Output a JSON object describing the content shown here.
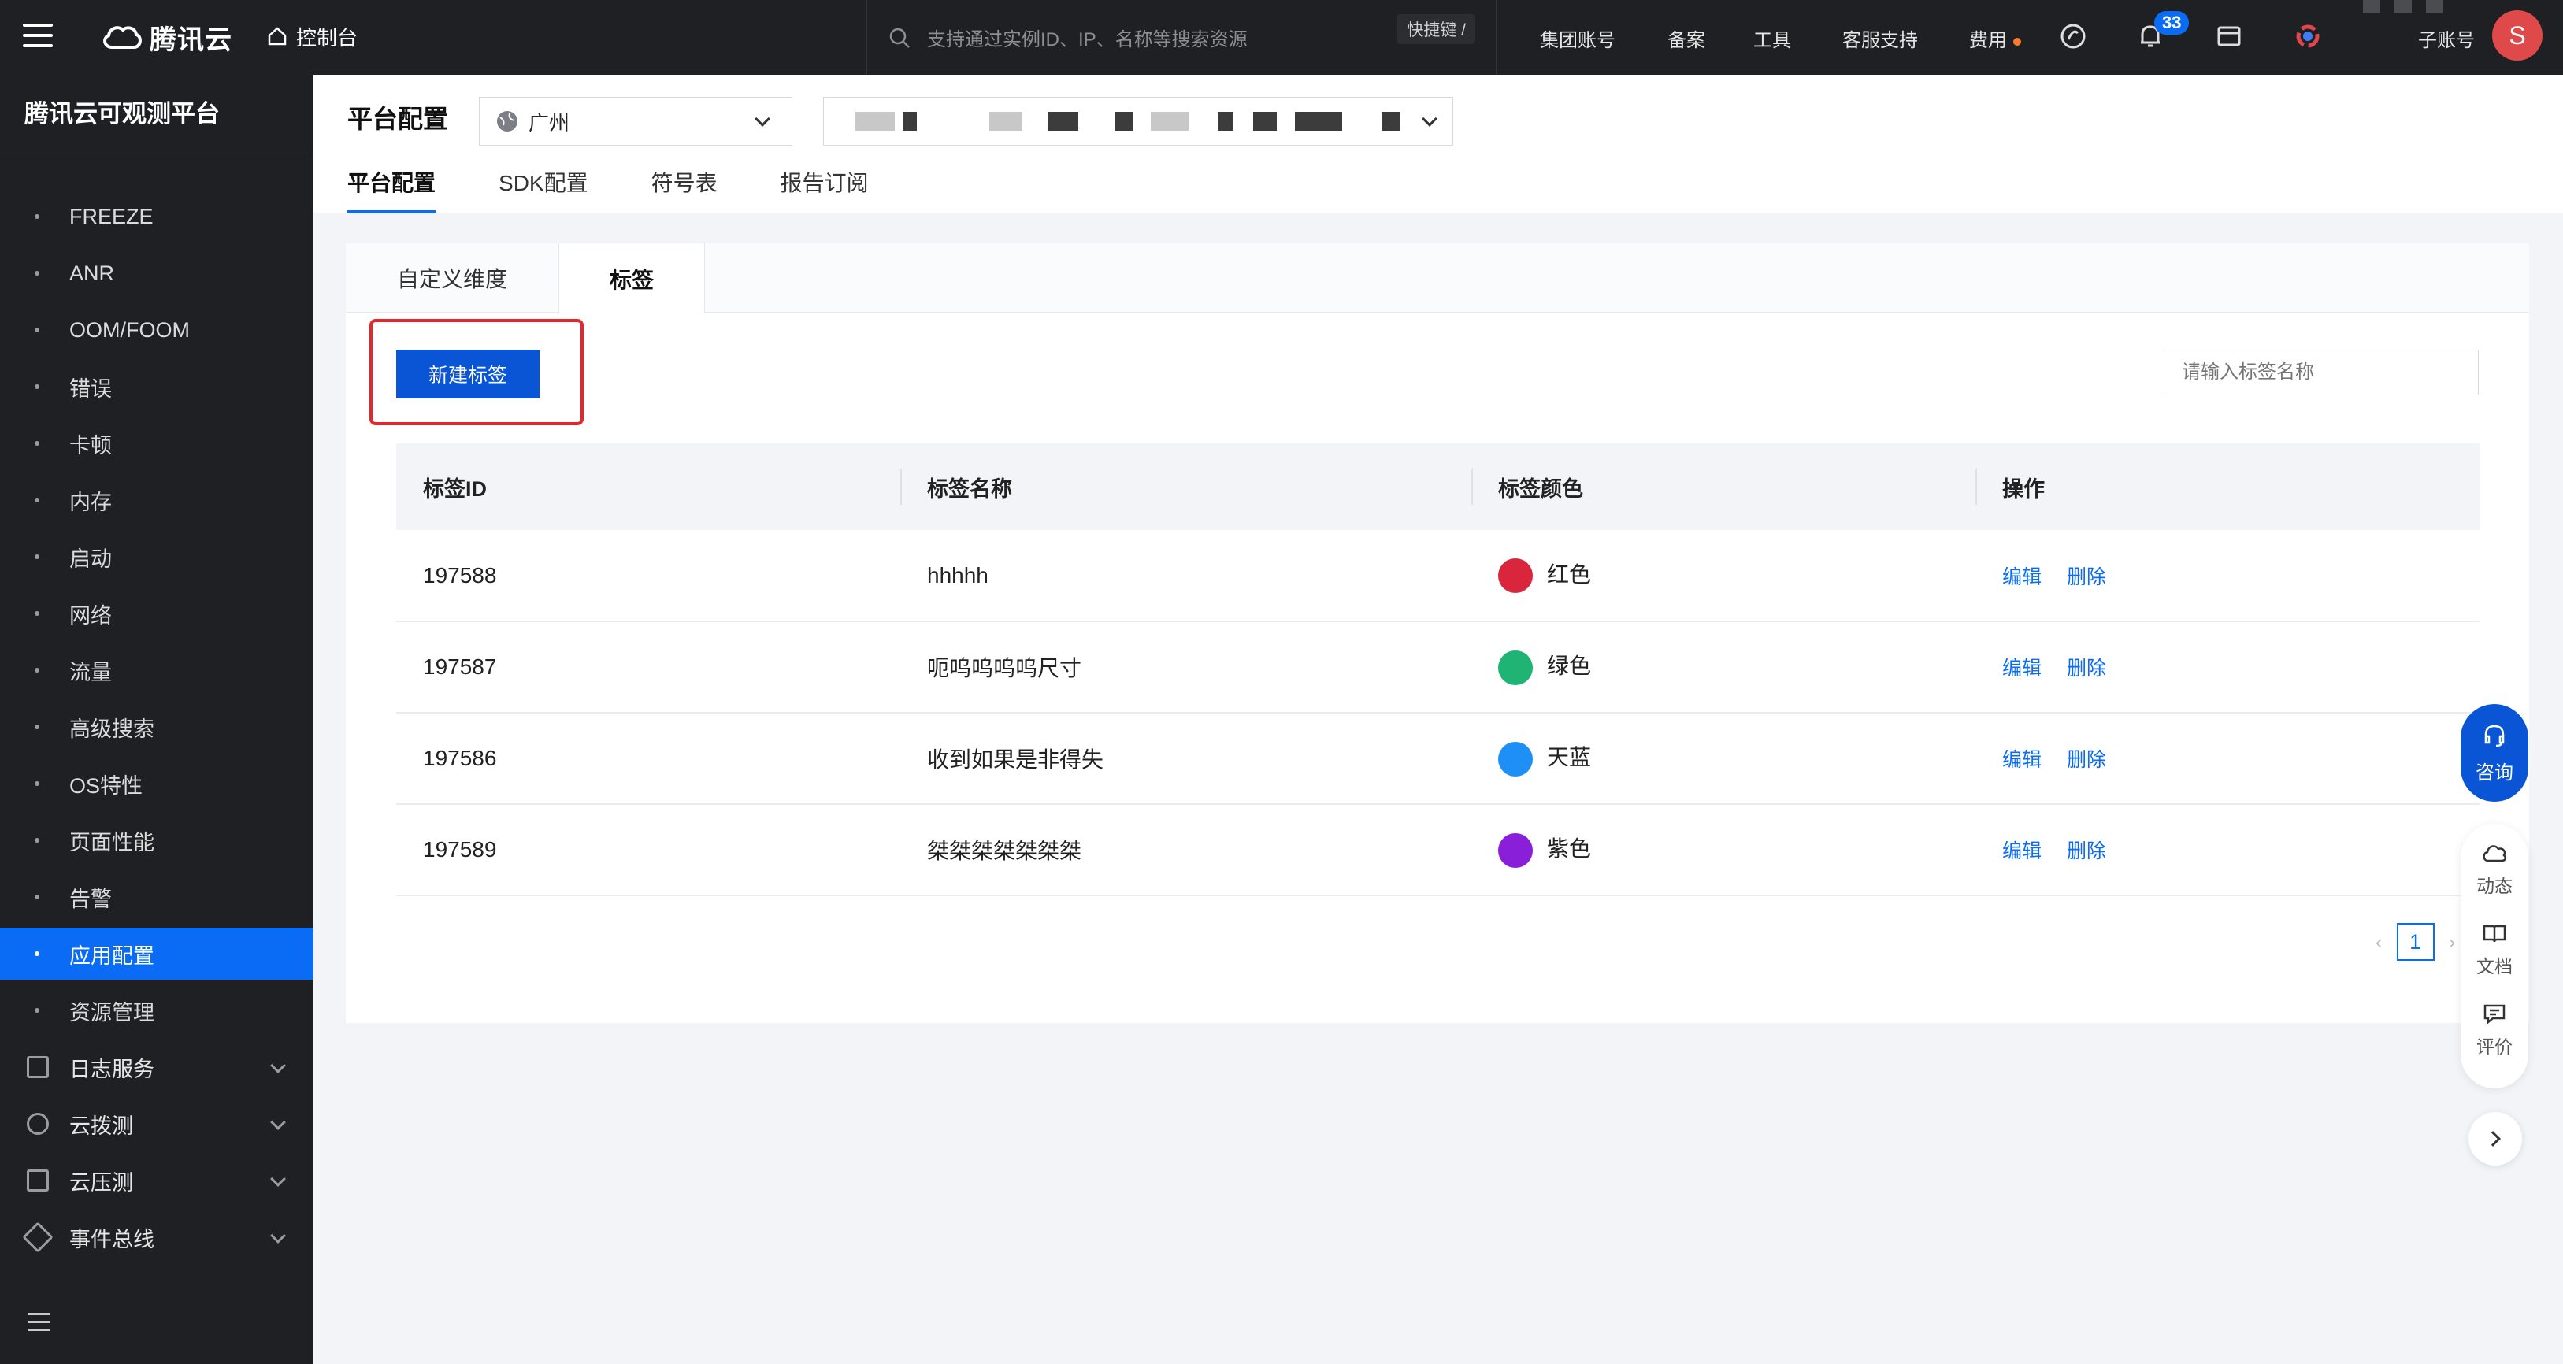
{
  "topbar": {
    "brand": "腾讯云",
    "console": "控制台",
    "search_placeholder": "支持通过实例ID、IP、名称等搜索资源",
    "shortcut": "快捷键 /",
    "links": [
      "集团账号",
      "备案",
      "工具",
      "客服支持",
      "费用"
    ],
    "notification_count": "33",
    "account": "子账号",
    "avatar": "S"
  },
  "sidebar": {
    "title": "腾讯云可观测平台",
    "items": [
      "FREEZE",
      "ANR",
      "OOM/FOOM",
      "错误",
      "卡顿",
      "内存",
      "启动",
      "网络",
      "流量",
      "高级搜索",
      "OS特性",
      "页面性能",
      "告警",
      "应用配置",
      "资源管理"
    ],
    "active_item": "应用配置",
    "groups": [
      "日志服务",
      "云拨测",
      "云压测",
      "事件总线"
    ]
  },
  "header": {
    "title": "平台配置",
    "region": "广州",
    "tabs": [
      "平台配置",
      "SDK配置",
      "符号表",
      "报告订阅"
    ],
    "active_tab": "平台配置"
  },
  "card": {
    "subtabs": [
      "自定义维度",
      "标签"
    ],
    "active_subtab": "标签",
    "new_button": "新建标签",
    "search_placeholder": "请输入标签名称",
    "columns": [
      "标签ID",
      "标签名称",
      "标签颜色",
      "操作"
    ],
    "rows": [
      {
        "id": "197588",
        "name": "hhhhh",
        "color_name": "红色",
        "color": "#d9263d"
      },
      {
        "id": "197587",
        "name": "呃呜呜呜呜尺寸",
        "color_name": "绿色",
        "color": "#1fb374"
      },
      {
        "id": "197586",
        "name": "收到如果是非得失",
        "color_name": "天蓝",
        "color": "#1e90f5"
      },
      {
        "id": "197589",
        "name": "桀桀桀桀桀桀桀",
        "color_name": "紫色",
        "color": "#8a1fd9"
      }
    ],
    "actions": {
      "edit": "编辑",
      "delete": "删除"
    },
    "page": "1"
  },
  "float_tools": {
    "consult": "咨询",
    "items": [
      "动态",
      "文档",
      "评价"
    ]
  },
  "colors": {
    "accent": "#0a6cf5",
    "topbar_bg": "#1f2023",
    "highlight": "#e5262a"
  }
}
